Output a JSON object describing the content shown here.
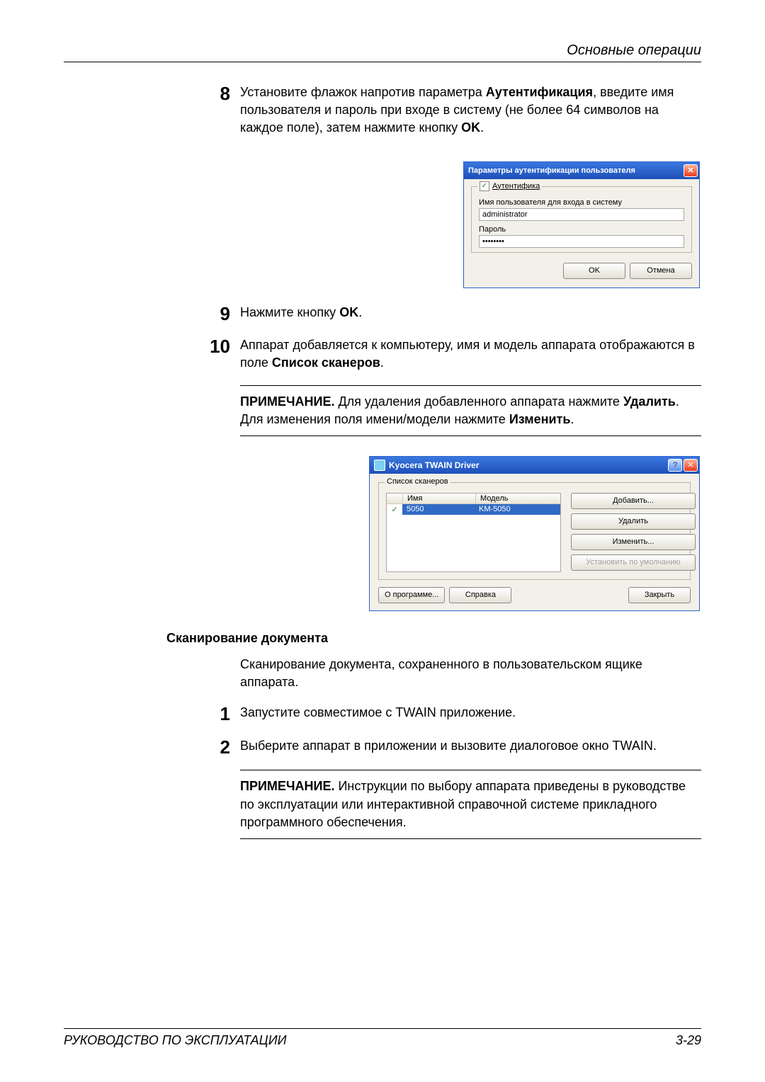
{
  "header": {
    "section_title": "Основные операции"
  },
  "steps": {
    "s8": {
      "num": "8",
      "text_a": "Установите флажок напротив параметра ",
      "bold_a": "Аутентификация",
      "text_b": ", введите имя пользователя и пароль при входе в систему (не более 64 символов на каждое поле), затем нажмите кнопку ",
      "bold_b": "OK",
      "text_c": "."
    },
    "s9": {
      "num": "9",
      "text_a": "Нажмите кнопку ",
      "bold_a": "OK",
      "text_b": "."
    },
    "s10": {
      "num": "10",
      "text_a": "Аппарат добавляется к компьютеру, имя и модель аппарата отображаются в поле ",
      "bold_a": "Список сканеров",
      "text_b": "."
    },
    "scan1": {
      "num": "1",
      "text": "Запустите совместимое с TWAIN приложение."
    },
    "scan2": {
      "num": "2",
      "text": "Выберите аппарат в приложении и вызовите диалоговое окно TWAIN."
    }
  },
  "notes": {
    "n1": {
      "label": "ПРИМЕЧАНИЕ.",
      "text_a": " Для удаления добавленного аппарата нажмите ",
      "bold_a": "Удалить",
      "text_b": ". Для изменения поля имени/модели нажмите ",
      "bold_b": "Изменить",
      "text_c": "."
    },
    "n2": {
      "label": "ПРИМЕЧАНИЕ.",
      "text": " Инструкции по выбору аппарата приведены в руководстве по эксплуатации или интерактивной справочной системе прикладного программного обеспечения."
    }
  },
  "subheading": "Сканирование документа",
  "subtext": "Сканирование документа, сохраненного в пользовательском ящике аппарата.",
  "dialog1": {
    "title": "Параметры аутентификации пользователя",
    "checkbox_label": "Аутентифика",
    "check_mark": "✓",
    "field1_label": "Имя пользователя для входа в систему",
    "field1_value": "administrator",
    "field2_label": "Пароль",
    "field2_value": "••••••••",
    "ok": "OK",
    "cancel": "Отмена",
    "close_x": "✕"
  },
  "dialog2": {
    "title": "Kyocera TWAIN Driver",
    "group_label": "Список сканеров",
    "col_name": "Имя",
    "col_model": "Модель",
    "row_check": "✓",
    "row_name": "5050",
    "row_model": "KM-5050",
    "btn_add": "Добавить...",
    "btn_delete": "Удалить",
    "btn_edit": "Изменить...",
    "btn_default": "Установить по умолчанию",
    "btn_about": "О программе...",
    "btn_help": "Справка",
    "btn_close": "Закрыть",
    "help_q": "?",
    "close_x": "✕"
  },
  "footer": {
    "left": "РУКОВОДСТВО ПО ЭКСПЛУАТАЦИИ",
    "right": "3-29"
  }
}
